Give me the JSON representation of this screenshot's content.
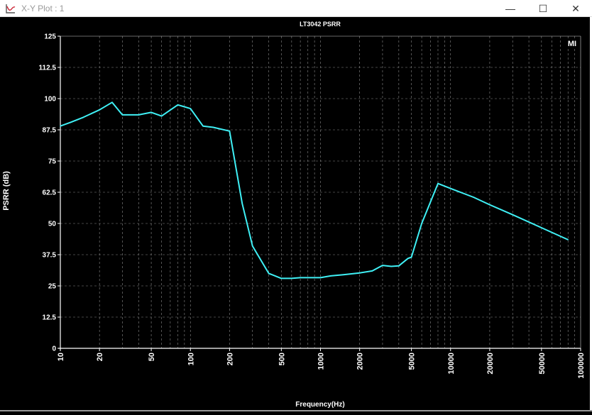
{
  "window": {
    "title": "X-Y Plot : 1",
    "icon": "xy-plot-icon",
    "controls": {
      "minimize": "—",
      "maximize": "☐",
      "close": "✕"
    }
  },
  "chart_data": {
    "type": "line",
    "title": "LT3042 PSRR",
    "xlabel": "Frequency(Hz)",
    "ylabel": "PSRR (dB)",
    "xscale": "log",
    "xlim": [
      10,
      100000
    ],
    "ylim": [
      0,
      125
    ],
    "grid": true,
    "badge": "MI",
    "yticks": [
      0,
      12.5,
      25,
      37.5,
      50,
      62.5,
      75,
      87.5,
      100,
      112.5,
      125
    ],
    "ytick_labels": [
      "0",
      "12.5",
      "25",
      "37.5",
      "50",
      "62.5",
      "75",
      "87.5",
      "100",
      "112.5",
      "125"
    ],
    "xticks": [
      10,
      20,
      50,
      100,
      200,
      500,
      1000,
      2000,
      5000,
      10000,
      20000,
      50000,
      100000
    ],
    "xtick_labels": [
      "10",
      "20",
      "50",
      "100",
      "200",
      "500",
      "1000",
      "2000",
      "5000",
      "10000",
      "20000",
      "50000",
      "100000"
    ],
    "series": [
      {
        "color": "#3ff0f5",
        "x": [
          10,
          12,
          15,
          20,
          25,
          30,
          40,
          50,
          60,
          80,
          100,
          125,
          150,
          200,
          250,
          300,
          400,
          500,
          600,
          700,
          800,
          1000,
          1200,
          1500,
          2000,
          2500,
          3000,
          3500,
          4000,
          4700,
          5000,
          6000,
          8000,
          10000,
          15000,
          20000,
          30000,
          50000,
          80000
        ],
        "y": [
          89,
          90.5,
          92.5,
          95.5,
          98.5,
          93.5,
          93.5,
          94.5,
          93,
          97.5,
          96,
          89,
          88.5,
          87,
          58,
          41,
          30,
          28,
          28,
          28.3,
          28.3,
          28.3,
          29,
          29.5,
          30.2,
          31,
          33.2,
          32.8,
          33,
          36,
          36.5,
          50,
          66,
          64,
          60.5,
          57.5,
          53.5,
          48.3,
          43.5
        ]
      }
    ]
  }
}
